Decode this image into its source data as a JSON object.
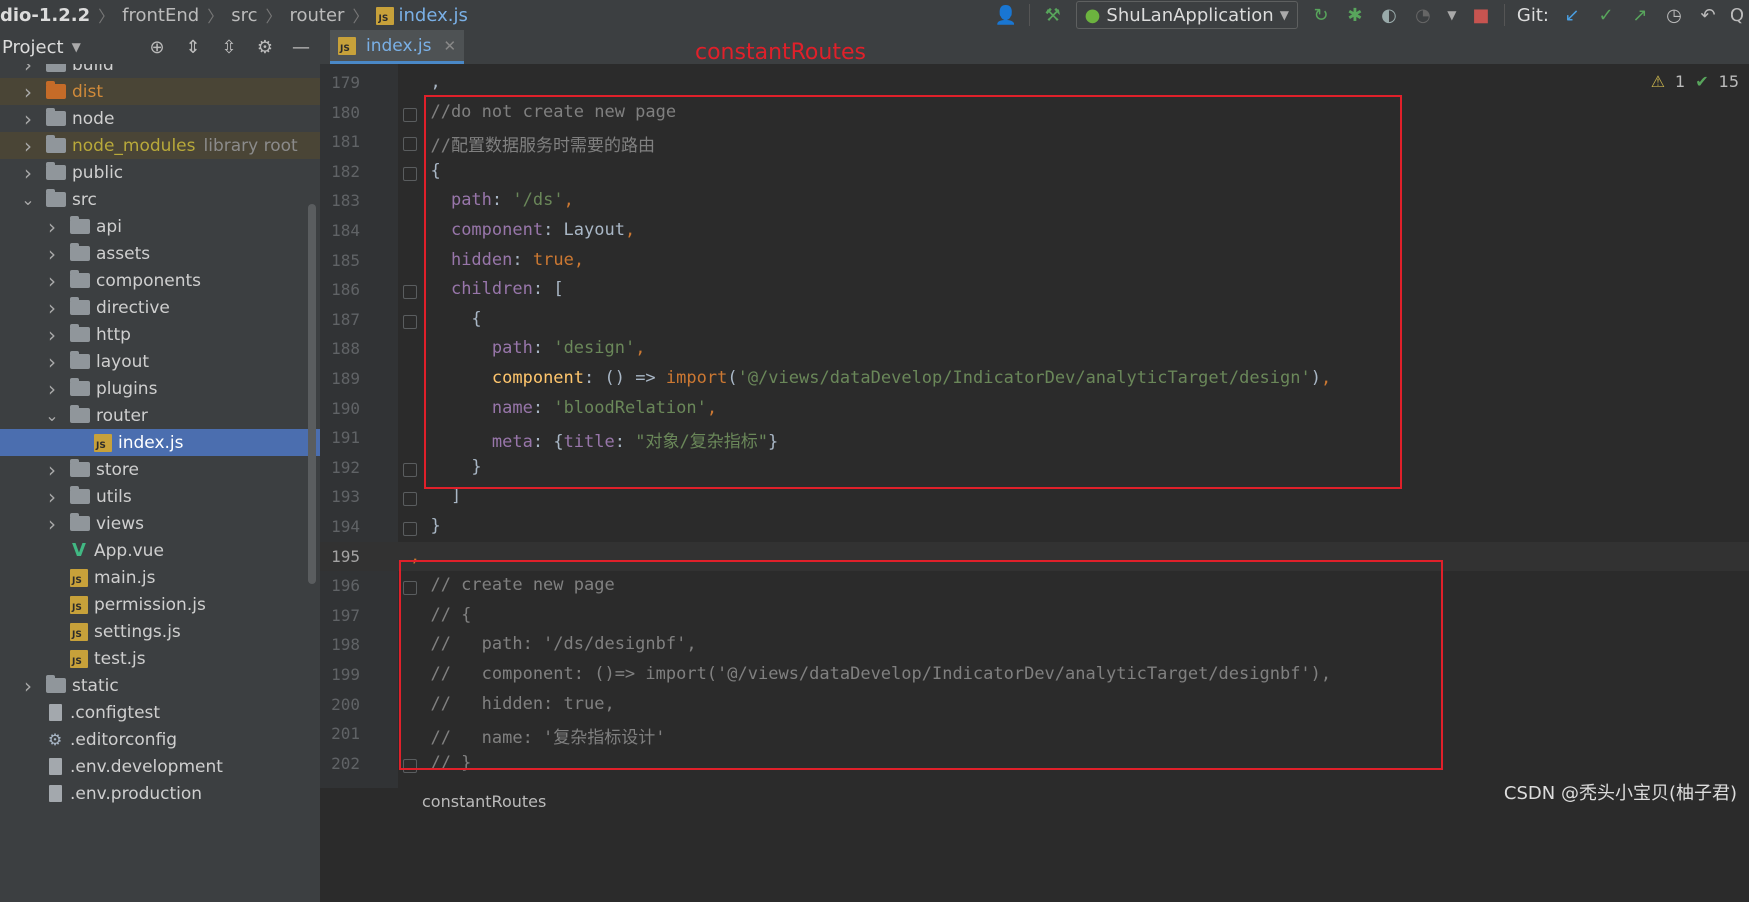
{
  "breadcrumb": {
    "items": [
      "dio-1.2.2",
      "frontEnd",
      "src",
      "router",
      "index.js"
    ]
  },
  "toolbar": {
    "run_config": "ShuLanApplication",
    "git_label": "Git:",
    "user_icon": "user-icon",
    "build_icon": "hammer-icon"
  },
  "project_panel": {
    "title": "Project",
    "tree": [
      {
        "label": "build",
        "type": "folder",
        "depth": 0,
        "expanded": false
      },
      {
        "label": "dist",
        "type": "folder-excluded",
        "depth": 0,
        "expanded": false
      },
      {
        "label": "node",
        "type": "folder",
        "depth": 0,
        "expanded": false
      },
      {
        "label": "node_modules",
        "suffix": "library root",
        "type": "folder-library",
        "depth": 0,
        "expanded": false
      },
      {
        "label": "public",
        "type": "folder",
        "depth": 0,
        "expanded": false
      },
      {
        "label": "src",
        "type": "folder",
        "depth": 0,
        "expanded": true
      },
      {
        "label": "api",
        "type": "folder",
        "depth": 1,
        "expanded": false
      },
      {
        "label": "assets",
        "type": "folder",
        "depth": 1,
        "expanded": false
      },
      {
        "label": "components",
        "type": "folder",
        "depth": 1,
        "expanded": false
      },
      {
        "label": "directive",
        "type": "folder",
        "depth": 1,
        "expanded": false
      },
      {
        "label": "http",
        "type": "folder",
        "depth": 1,
        "expanded": false
      },
      {
        "label": "layout",
        "type": "folder",
        "depth": 1,
        "expanded": false
      },
      {
        "label": "plugins",
        "type": "folder",
        "depth": 1,
        "expanded": false
      },
      {
        "label": "router",
        "type": "folder",
        "depth": 1,
        "expanded": true
      },
      {
        "label": "index.js",
        "type": "js",
        "depth": 2,
        "selected": true
      },
      {
        "label": "store",
        "type": "folder",
        "depth": 1,
        "expanded": false
      },
      {
        "label": "utils",
        "type": "folder",
        "depth": 1,
        "expanded": false
      },
      {
        "label": "views",
        "type": "folder",
        "depth": 1,
        "expanded": false
      },
      {
        "label": "App.vue",
        "type": "vue",
        "depth": 1
      },
      {
        "label": "main.js",
        "type": "js",
        "depth": 1
      },
      {
        "label": "permission.js",
        "type": "js",
        "depth": 1
      },
      {
        "label": "settings.js",
        "type": "js",
        "depth": 1
      },
      {
        "label": "test.js",
        "type": "js",
        "depth": 1
      },
      {
        "label": "static",
        "type": "folder",
        "depth": 0,
        "expanded": false
      },
      {
        "label": ".configtest",
        "type": "file",
        "depth": 0
      },
      {
        "label": ".editorconfig",
        "type": "config",
        "depth": 0
      },
      {
        "label": ".env.development",
        "type": "file",
        "depth": 0
      },
      {
        "label": ".env.production",
        "type": "file",
        "depth": 0
      }
    ]
  },
  "editor": {
    "tab_label": "index.js",
    "annotation": "constantRoutes",
    "inspection": {
      "warnings": "1",
      "ok": "15"
    },
    "bottom_breadcrumb": "constantRoutes",
    "current_line": 195,
    "lines": [
      {
        "num": "179",
        "tokens": [
          [
            "  ,",
            "plain"
          ]
        ]
      },
      {
        "num": "180",
        "tokens": [
          [
            "  //do not create new page",
            "comment"
          ]
        ]
      },
      {
        "num": "181",
        "tokens": [
          [
            "  //配置数据服务时需要的路由",
            "comment"
          ]
        ]
      },
      {
        "num": "182",
        "tokens": [
          [
            "  {",
            "plain"
          ]
        ]
      },
      {
        "num": "183",
        "tokens": [
          [
            "    ",
            "plain"
          ],
          [
            "path",
            "prop"
          ],
          [
            ": ",
            "plain"
          ],
          [
            "'/ds'",
            "str"
          ],
          [
            ",",
            "punct"
          ]
        ]
      },
      {
        "num": "184",
        "tokens": [
          [
            "    ",
            "plain"
          ],
          [
            "component",
            "prop"
          ],
          [
            ": Layout",
            "plain"
          ],
          [
            ",",
            "punct"
          ]
        ]
      },
      {
        "num": "185",
        "tokens": [
          [
            "    ",
            "plain"
          ],
          [
            "hidden",
            "prop"
          ],
          [
            ": ",
            "plain"
          ],
          [
            "true",
            "kw"
          ],
          [
            ",",
            "punct"
          ]
        ]
      },
      {
        "num": "186",
        "tokens": [
          [
            "    ",
            "plain"
          ],
          [
            "children",
            "prop"
          ],
          [
            ": [",
            "plain"
          ]
        ]
      },
      {
        "num": "187",
        "tokens": [
          [
            "      {",
            "plain"
          ]
        ]
      },
      {
        "num": "188",
        "tokens": [
          [
            "        ",
            "plain"
          ],
          [
            "path",
            "prop"
          ],
          [
            ": ",
            "plain"
          ],
          [
            "'design'",
            "str"
          ],
          [
            ",",
            "punct"
          ]
        ]
      },
      {
        "num": "189",
        "tokens": [
          [
            "        ",
            "plain"
          ],
          [
            "component",
            "fn"
          ],
          [
            ": () => ",
            "plain"
          ],
          [
            "import",
            "kw"
          ],
          [
            "(",
            "plain"
          ],
          [
            "'@/views/dataDevelop/IndicatorDev/analyticTarget/design'",
            "str"
          ],
          [
            ")",
            "plain"
          ],
          [
            ",",
            "punct"
          ]
        ]
      },
      {
        "num": "190",
        "tokens": [
          [
            "        ",
            "plain"
          ],
          [
            "name",
            "prop"
          ],
          [
            ": ",
            "plain"
          ],
          [
            "'bloodRelation'",
            "str"
          ],
          [
            ",",
            "punct"
          ]
        ]
      },
      {
        "num": "191",
        "tokens": [
          [
            "        ",
            "plain"
          ],
          [
            "meta",
            "prop"
          ],
          [
            ": {",
            "plain"
          ],
          [
            "title",
            "prop"
          ],
          [
            ": ",
            "plain"
          ],
          [
            "\"对象/复杂指标\"",
            "str"
          ],
          [
            "}",
            "plain"
          ]
        ]
      },
      {
        "num": "192",
        "tokens": [
          [
            "      }",
            "plain"
          ]
        ]
      },
      {
        "num": "193",
        "tokens": [
          [
            "    ]",
            "plain"
          ]
        ]
      },
      {
        "num": "194",
        "tokens": [
          [
            "  }",
            "plain"
          ]
        ]
      },
      {
        "num": "195",
        "tokens": [
          [
            ",",
            "punct"
          ]
        ]
      },
      {
        "num": "196",
        "tokens": [
          [
            "  // create new page",
            "comment"
          ]
        ]
      },
      {
        "num": "197",
        "tokens": [
          [
            "  // {",
            "comment"
          ]
        ]
      },
      {
        "num": "198",
        "tokens": [
          [
            "  //   path: '/ds/designbf',",
            "comment"
          ]
        ]
      },
      {
        "num": "199",
        "tokens": [
          [
            "  //   component: ()=> import('@/views/dataDevelop/IndicatorDev/analyticTarget/designbf'),",
            "comment"
          ]
        ]
      },
      {
        "num": "200",
        "tokens": [
          [
            "  //   hidden: true,",
            "comment"
          ]
        ]
      },
      {
        "num": "201",
        "tokens": [
          [
            "  //   name: '复杂指标设计'",
            "comment"
          ]
        ]
      },
      {
        "num": "202",
        "tokens": [
          [
            "  // }",
            "comment"
          ]
        ]
      }
    ]
  },
  "watermark": "CSDN @秃头小宝贝(柚子君)"
}
